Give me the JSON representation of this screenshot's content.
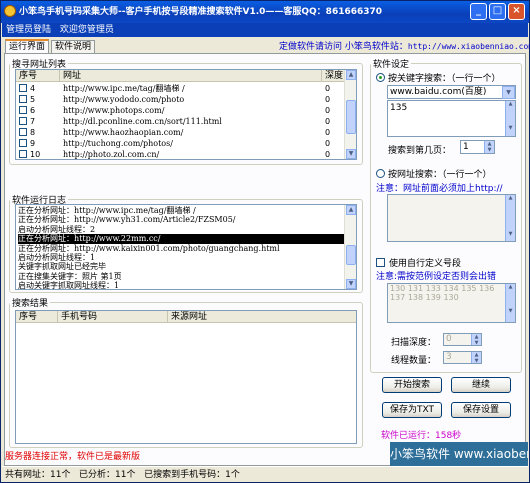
{
  "window": {
    "title": "小笨鸟手机号码采集大师--客户手机按号段精准搜索软件V1.0——客服QQ：861666370",
    "min": "_",
    "max": "□",
    "close": "×"
  },
  "userbar": {
    "admin_login": "管理员登陆",
    "welcome": "欢迎您管理员"
  },
  "tabs": [
    {
      "label": "运行界面"
    },
    {
      "label": "软件说明"
    }
  ],
  "topinfo": {
    "text": "定做软件请访问   小笨鸟软件站：",
    "url": "http://www.xiaobenniao.com/"
  },
  "url_list": {
    "legend": "搜寻网址列表",
    "columns": [
      "序号",
      "网址",
      "深度"
    ],
    "rows": [
      {
        "no": "4",
        "url": "http://www.ipc.me/tag/翻墙梯  /",
        "depth": "0"
      },
      {
        "no": "5",
        "url": "http://www.yododo.com/photo",
        "depth": "0"
      },
      {
        "no": "6",
        "url": "http://www.photops.com/",
        "depth": "0"
      },
      {
        "no": "7",
        "url": "http://dl.pconline.com.cn/sort/111.html",
        "depth": "0"
      },
      {
        "no": "8",
        "url": "http://www.haozhaopian.com/",
        "depth": "0"
      },
      {
        "no": "9",
        "url": "http://tuchong.com/photos/",
        "depth": "0"
      },
      {
        "no": "10",
        "url": "http://photo.zol.com.cn/",
        "depth": "0"
      }
    ]
  },
  "log": {
    "legend": "软件运行日志",
    "lines": [
      "正在分析网址：http://www.ipc.me/tag/翻墙梯  /",
      "正在分析网址：http://www.yh31.com/Article2/FZSM05/",
      "启动分析网址线程：2",
      "正在分析网址：http://www.22mm.cc/",
      "正在分析网址：http://www.kaixin001.com/photo/guangchang.html",
      "启动分析网址线程：1",
      "关键字抓取网址已经完毕",
      "正在搜集关键字：照片      第1页",
      "启动关键字抓取网址线程：1"
    ],
    "selected_index": 3
  },
  "results": {
    "legend": "搜索结果",
    "columns": [
      "序号",
      "手机号码",
      "来源网址"
    ]
  },
  "settings": {
    "legend": "软件设定",
    "by_keyword_label": "按关键字搜索：（一行一个）",
    "engine_value": "www.baidu.com(百度)",
    "keywords_value": "135",
    "pages_label": "搜索到第几页：",
    "pages_value": "1",
    "by_url_label": "按网址搜索：（一行一个）",
    "url_note": "注意：网址前面必须加上http://",
    "custom_segment_label": "使用自行定义号段",
    "segment_note": "注意:需按范例设定否则会出错",
    "segment_example": "130 131 133 134 135 136 137 138 139 130",
    "depth_label": "扫描深度：",
    "depth_value": "0",
    "threads_label": "线程数量：",
    "threads_value": "3"
  },
  "buttons": {
    "start": "开始搜索",
    "continue": "继续",
    "save_txt": "保存为TXT",
    "save_settings": "保存设置"
  },
  "runtime": "软件已运行：158秒",
  "server_status": "服务器连接正常，软件已是最新版",
  "brand": "小笨鸟软件 www.xiaobenniao.com",
  "statusbar": {
    "total": "共有网址：11个",
    "analyzed": "已分析：11个",
    "found": "已搜索到手机号码：1个"
  },
  "colors": {
    "title_bar": "#0a3fb8",
    "accent_blue": "#0000cc",
    "status_red": "#e00000",
    "runtime_magenta": "#cc00cc",
    "brand_bg": "#2e6f99"
  }
}
